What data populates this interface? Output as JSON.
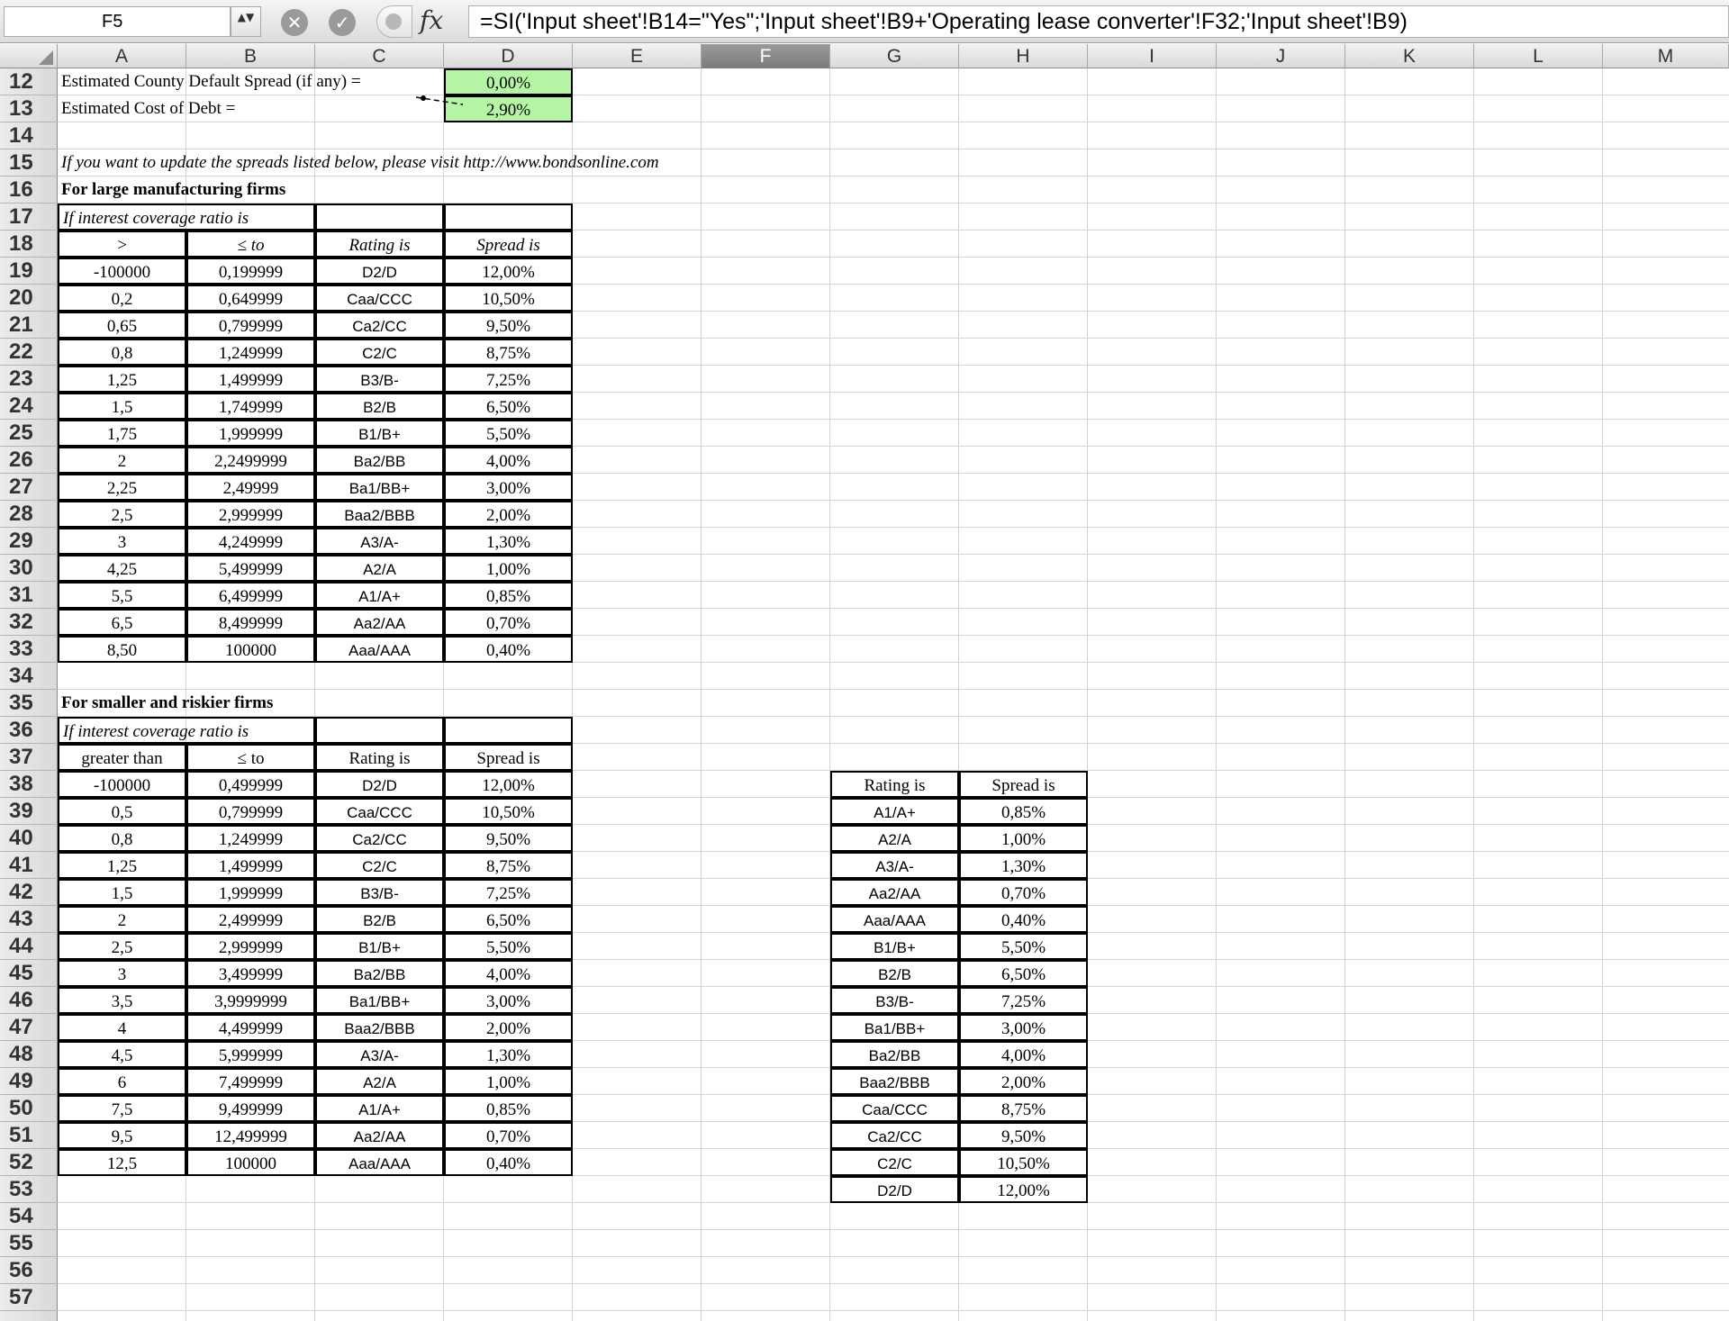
{
  "formula_bar": {
    "cell_ref": "F5",
    "stepper_icon": "▲▼",
    "cancel_icon": "✕",
    "confirm_icon": "✓",
    "fx_label": "fx",
    "formula": "=SI('Input sheet'!B14=\"Yes\";'Input sheet'!B9+'Operating lease converter'!F32;'Input sheet'!B9)"
  },
  "columns": [
    "A",
    "B",
    "C",
    "D",
    "E",
    "F",
    "G",
    "H",
    "I",
    "J",
    "K",
    "L",
    "M"
  ],
  "active_column": "F",
  "rows": [
    "12",
    "13",
    "14",
    "15",
    "16",
    "17",
    "18",
    "19",
    "20",
    "21",
    "22",
    "23",
    "24",
    "25",
    "26",
    "27",
    "28",
    "29",
    "30",
    "31",
    "32",
    "33",
    "34",
    "35",
    "36",
    "37",
    "38",
    "39",
    "40",
    "41",
    "42",
    "43",
    "44",
    "45",
    "46",
    "47",
    "48",
    "49",
    "50",
    "51",
    "52",
    "53",
    "54",
    "55",
    "56",
    "57"
  ],
  "top": {
    "spread_label": "Estimated County Default Spread (if any) =",
    "spread_value": "0,00%",
    "cost_label": "Estimated Cost of Debt =",
    "cost_value": "2,90%",
    "note": "If you want to update the spreads listed below, please visit http://www.bondsonline.com"
  },
  "large": {
    "title": "For large manufacturing firms",
    "subtitle": "If interest coverage ratio is",
    "headers": [
      ">",
      "≤ to",
      "Rating is",
      "Spread is"
    ],
    "rows": [
      [
        "-100000",
        "0,199999",
        "D2/D",
        "12,00%"
      ],
      [
        "0,2",
        "0,649999",
        "Caa/CCC",
        "10,50%"
      ],
      [
        "0,65",
        "0,799999",
        "Ca2/CC",
        "9,50%"
      ],
      [
        "0,8",
        "1,249999",
        "C2/C",
        "8,75%"
      ],
      [
        "1,25",
        "1,499999",
        "B3/B-",
        "7,25%"
      ],
      [
        "1,5",
        "1,749999",
        "B2/B",
        "6,50%"
      ],
      [
        "1,75",
        "1,999999",
        "B1/B+",
        "5,50%"
      ],
      [
        "2",
        "2,2499999",
        "Ba2/BB",
        "4,00%"
      ],
      [
        "2,25",
        "2,49999",
        "Ba1/BB+",
        "3,00%"
      ],
      [
        "2,5",
        "2,999999",
        "Baa2/BBB",
        "2,00%"
      ],
      [
        "3",
        "4,249999",
        "A3/A-",
        "1,30%"
      ],
      [
        "4,25",
        "5,499999",
        "A2/A",
        "1,00%"
      ],
      [
        "5,5",
        "6,499999",
        "A1/A+",
        "0,85%"
      ],
      [
        "6,5",
        "8,499999",
        "Aa2/AA",
        "0,70%"
      ],
      [
        "8,50",
        "100000",
        "Aaa/AAA",
        "0,40%"
      ]
    ]
  },
  "small": {
    "title": "For smaller and riskier firms",
    "subtitle": "If interest coverage ratio is",
    "headers": [
      "greater than",
      "≤ to",
      "Rating is",
      "Spread is"
    ],
    "rows": [
      [
        "-100000",
        "0,499999",
        "D2/D",
        "12,00%"
      ],
      [
        "0,5",
        "0,799999",
        "Caa/CCC",
        "10,50%"
      ],
      [
        "0,8",
        "1,249999",
        "Ca2/CC",
        "9,50%"
      ],
      [
        "1,25",
        "1,499999",
        "C2/C",
        "8,75%"
      ],
      [
        "1,5",
        "1,999999",
        "B3/B-",
        "7,25%"
      ],
      [
        "2",
        "2,499999",
        "B2/B",
        "6,50%"
      ],
      [
        "2,5",
        "2,999999",
        "B1/B+",
        "5,50%"
      ],
      [
        "3",
        "3,499999",
        "Ba2/BB",
        "4,00%"
      ],
      [
        "3,5",
        "3,9999999",
        "Ba1/BB+",
        "3,00%"
      ],
      [
        "4",
        "4,499999",
        "Baa2/BBB",
        "2,00%"
      ],
      [
        "4,5",
        "5,999999",
        "A3/A-",
        "1,30%"
      ],
      [
        "6",
        "7,499999",
        "A2/A",
        "1,00%"
      ],
      [
        "7,5",
        "9,499999",
        "A1/A+",
        "0,85%"
      ],
      [
        "9,5",
        "12,499999",
        "Aa2/AA",
        "0,70%"
      ],
      [
        "12,5",
        "100000",
        "Aaa/AAA",
        "0,40%"
      ]
    ]
  },
  "lookup": {
    "headers": [
      "Rating is",
      "Spread is"
    ],
    "rows": [
      [
        "A1/A+",
        "0,85%"
      ],
      [
        "A2/A",
        "1,00%"
      ],
      [
        "A3/A-",
        "1,30%"
      ],
      [
        "Aa2/AA",
        "0,70%"
      ],
      [
        "Aaa/AAA",
        "0,40%"
      ],
      [
        "B1/B+",
        "5,50%"
      ],
      [
        "B2/B",
        "6,50%"
      ],
      [
        "B3/B-",
        "7,25%"
      ],
      [
        "Ba1/BB+",
        "3,00%"
      ],
      [
        "Ba2/BB",
        "4,00%"
      ],
      [
        "Baa2/BBB",
        "2,00%"
      ],
      [
        "Caa/CCC",
        "8,75%"
      ],
      [
        "Ca2/CC",
        "9,50%"
      ],
      [
        "C2/C",
        "10,50%"
      ],
      [
        "D2/D",
        "12,00%"
      ]
    ]
  }
}
